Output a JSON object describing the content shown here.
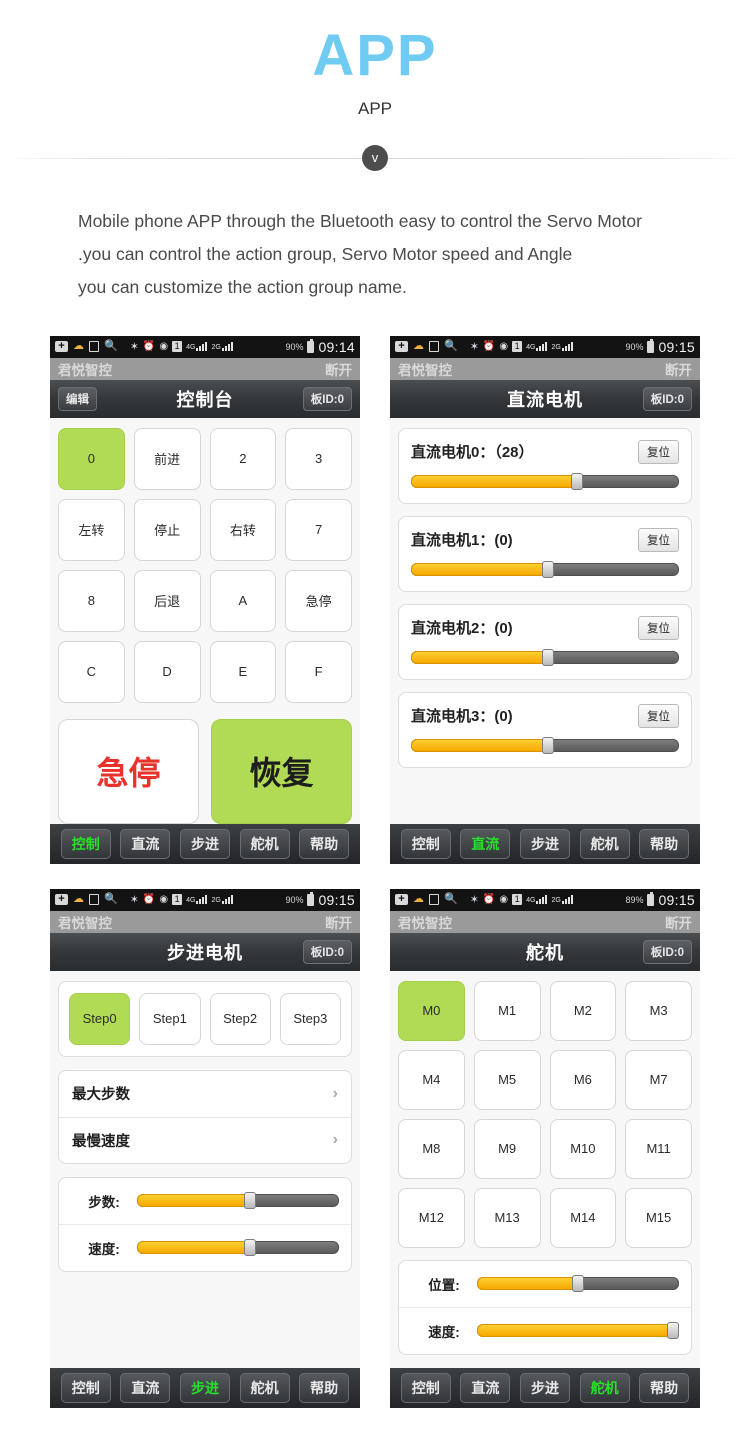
{
  "header": {
    "title": "APP",
    "subtitle": "APP",
    "badge_icon": "chevron-down-icon",
    "badge_glyph": "v",
    "accent_color": "#6fcbf2"
  },
  "intro": {
    "line1": "Mobile phone APP through the Bluetooth easy to control the Servo Motor",
    "line2": ".you can control the action group, Servo Motor speed and Angle",
    "line3": "you can customize the action group name."
  },
  "colors": {
    "green_active": "#b2db55",
    "slider_yellow": "#f5a900",
    "tab_active_green": "#27e02a",
    "stop_red": "#e8322a"
  },
  "status_bar": {
    "icons": [
      "plus-icon",
      "weather-cloud-icon",
      "document-icon",
      "search-icon",
      "bluetooth-icon",
      "alarm-icon",
      "wifi-icon",
      "sim-icon",
      "signal-4g-icon",
      "signal-2g-icon"
    ],
    "sim_label": "1",
    "net_label_top": "4G",
    "net_label_4g": "4G",
    "net_label_2g": "2G",
    "battery_90": "90%",
    "battery_89": "89%",
    "time_0914": "09:14",
    "time_0915": "09:15"
  },
  "app_strip": {
    "name": "君悦智控",
    "disconnect": "断开"
  },
  "tabs": {
    "items": [
      "控制",
      "直流",
      "步进",
      "舵机",
      "帮助"
    ]
  },
  "phones": [
    {
      "id": "console",
      "status_time": "09:14",
      "battery": "90%",
      "nav": {
        "left_button": "编辑",
        "title": "控制台",
        "right_button": "板ID:0"
      },
      "keys": [
        {
          "label": "0",
          "active": true
        },
        {
          "label": "前进",
          "active": false
        },
        {
          "label": "2",
          "active": false
        },
        {
          "label": "3",
          "active": false
        },
        {
          "label": "左转",
          "active": false
        },
        {
          "label": "停止",
          "active": false
        },
        {
          "label": "右转",
          "active": false
        },
        {
          "label": "7",
          "active": false
        },
        {
          "label": "8",
          "active": false
        },
        {
          "label": "后退",
          "active": false
        },
        {
          "label": "A",
          "active": false
        },
        {
          "label": "急停",
          "active": false
        },
        {
          "label": "C",
          "active": false
        },
        {
          "label": "D",
          "active": false
        },
        {
          "label": "E",
          "active": false
        },
        {
          "label": "F",
          "active": false
        }
      ],
      "big_buttons": [
        {
          "label": "急停",
          "style": "stop"
        },
        {
          "label": "恢复",
          "style": "resume"
        }
      ],
      "active_tab": "控制"
    },
    {
      "id": "dc-motor",
      "status_time": "09:15",
      "battery": "90%",
      "nav": {
        "left_button": "",
        "title": "直流电机",
        "right_button": "板ID:0"
      },
      "reset_label": "复位",
      "motors": [
        {
          "label": "直流电机0：（28）",
          "value": 28,
          "fill_percent": 62
        },
        {
          "label": "直流电机1：(0)",
          "value": 0,
          "fill_percent": 51
        },
        {
          "label": "直流电机2：(0)",
          "value": 0,
          "fill_percent": 51
        },
        {
          "label": "直流电机3：(0)",
          "value": 0,
          "fill_percent": 51
        }
      ],
      "active_tab": "直流"
    },
    {
      "id": "stepper-motor",
      "status_time": "09:15",
      "battery": "90%",
      "nav": {
        "left_button": "",
        "title": "步进电机",
        "right_button": "板ID:0"
      },
      "steps": [
        {
          "label": "Step0",
          "active": true
        },
        {
          "label": "Step1",
          "active": false
        },
        {
          "label": "Step2",
          "active": false
        },
        {
          "label": "Step3",
          "active": false
        }
      ],
      "list_rows": [
        {
          "label": "最大步数",
          "chevron": "›"
        },
        {
          "label": "最慢速度",
          "chevron": "›"
        }
      ],
      "sliders": [
        {
          "label": "步数:",
          "fill_percent": 56
        },
        {
          "label": "速度:",
          "fill_percent": 56
        }
      ],
      "active_tab": "步进"
    },
    {
      "id": "servo",
      "status_time": "09:15",
      "battery": "89%",
      "nav": {
        "left_button": "",
        "title": "舵机",
        "right_button": "板ID:0"
      },
      "servos": [
        {
          "label": "M0",
          "active": true
        },
        {
          "label": "M1",
          "active": false
        },
        {
          "label": "M2",
          "active": false
        },
        {
          "label": "M3",
          "active": false
        },
        {
          "label": "M4",
          "active": false
        },
        {
          "label": "M5",
          "active": false
        },
        {
          "label": "M6",
          "active": false
        },
        {
          "label": "M7",
          "active": false
        },
        {
          "label": "M8",
          "active": false
        },
        {
          "label": "M9",
          "active": false
        },
        {
          "label": "M10",
          "active": false
        },
        {
          "label": "M11",
          "active": false
        },
        {
          "label": "M12",
          "active": false
        },
        {
          "label": "M13",
          "active": false
        },
        {
          "label": "M14",
          "active": false
        },
        {
          "label": "M15",
          "active": false
        }
      ],
      "sliders": [
        {
          "label": "位置:",
          "fill_percent": 50
        },
        {
          "label": "速度:",
          "fill_percent": 97
        }
      ],
      "active_tab": "舵机"
    }
  ]
}
